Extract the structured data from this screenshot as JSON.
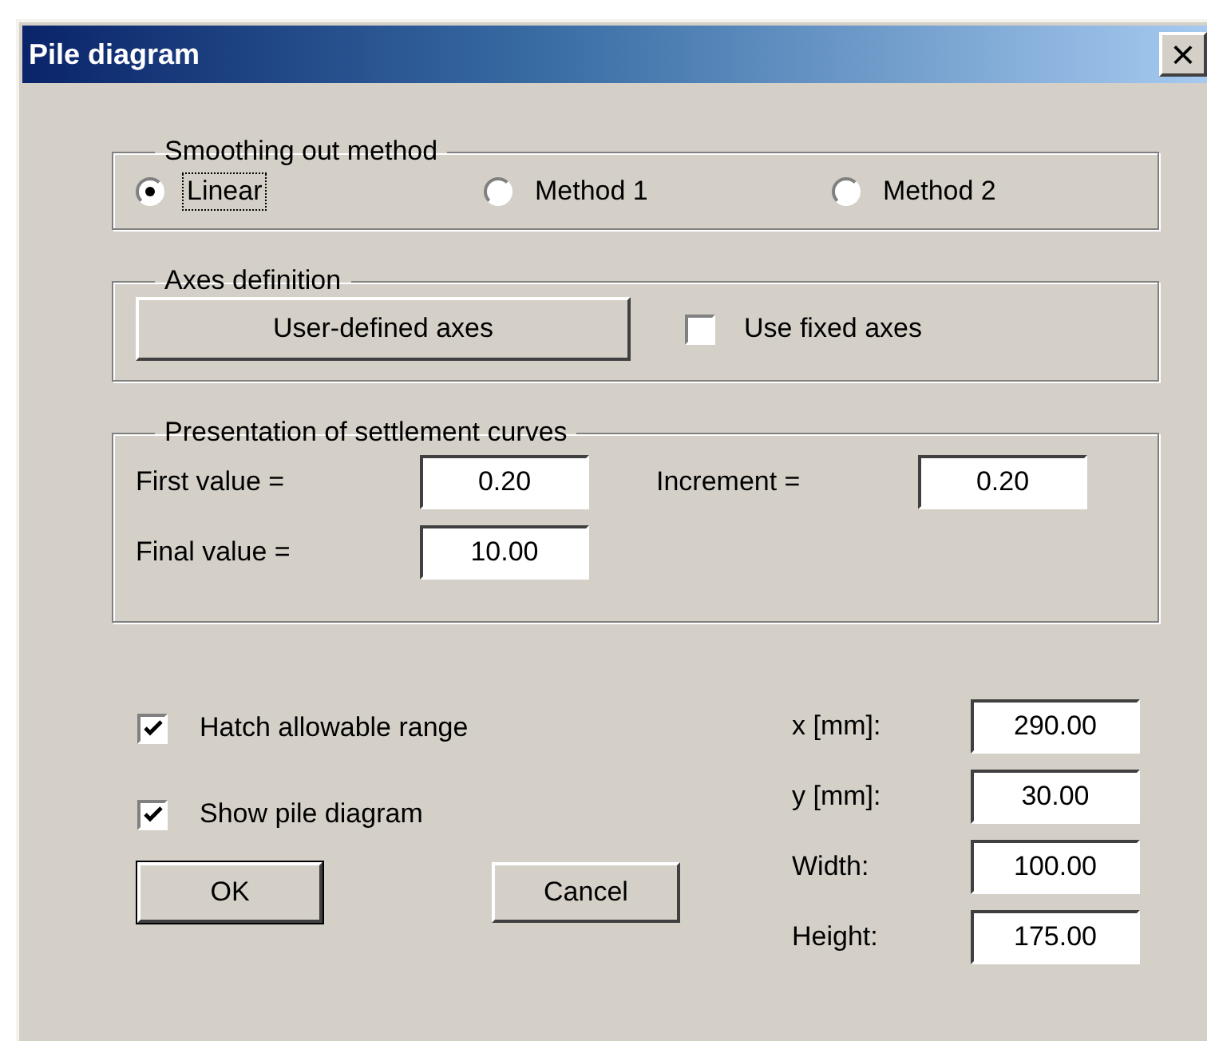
{
  "window": {
    "title": "Pile diagram",
    "close": "×"
  },
  "smoothing": {
    "legend": "Smoothing out method",
    "options": [
      {
        "label": "Linear",
        "selected": true,
        "focused": true
      },
      {
        "label": "Method 1",
        "selected": false,
        "focused": false
      },
      {
        "label": "Method 2",
        "selected": false,
        "focused": false
      }
    ]
  },
  "axes": {
    "legend": "Axes definition",
    "button": "User-defined axes",
    "fixed": {
      "label": "Use fixed axes",
      "checked": false
    }
  },
  "curves": {
    "legend": "Presentation of settlement curves",
    "first": {
      "label": "First value =",
      "value": "0.20"
    },
    "increment": {
      "label": "Increment =",
      "value": "0.20"
    },
    "final": {
      "label": "Final value =",
      "value": "10.00"
    }
  },
  "options": [
    {
      "label": "Hatch allowable range",
      "checked": true
    },
    {
      "label": "Show pile diagram",
      "checked": true
    }
  ],
  "buttons": [
    {
      "label": "OK",
      "default": true
    },
    {
      "label": "Cancel",
      "default": false
    }
  ],
  "placement": [
    {
      "label": "x [mm]:",
      "value": "290.00"
    },
    {
      "label": "y [mm]:",
      "value": "30.00"
    },
    {
      "label": "Width:",
      "value": "100.00"
    },
    {
      "label": "Height:",
      "value": "175.00"
    }
  ]
}
